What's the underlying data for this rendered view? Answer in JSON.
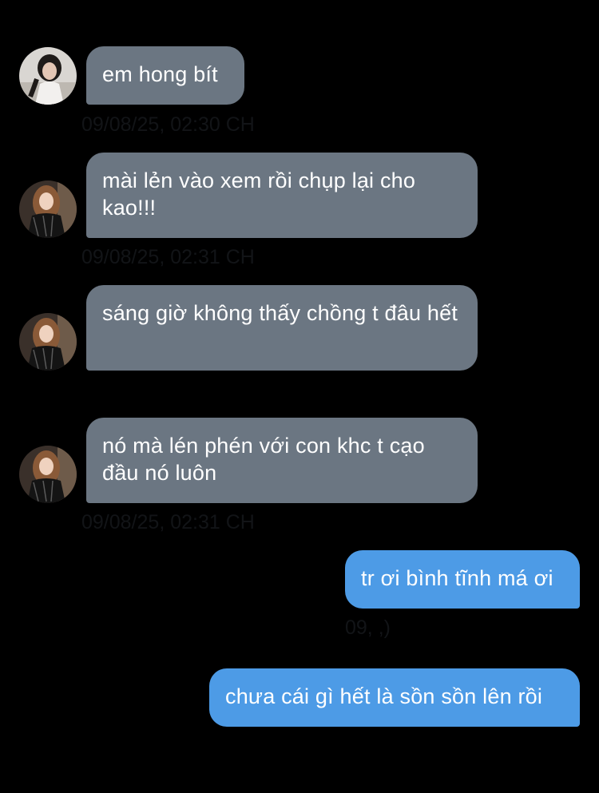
{
  "colors": {
    "background": "#000000",
    "incoming_bubble": "#6b7682",
    "outgoing_bubble": "#4d9be6",
    "timestamp": "#121417"
  },
  "messages": [
    {
      "direction": "incoming",
      "text": "em hong bít",
      "avatar": "avatar-dark-hair",
      "timestamp": "09/08/25, 02:30 CH"
    },
    {
      "direction": "incoming",
      "text": "mài lẻn vào xem rồi chụp lại cho kao!!!",
      "avatar": "avatar-long-hair",
      "timestamp": "09/08/25, 02:31 CH"
    },
    {
      "direction": "incoming",
      "text": "sáng giờ không thấy chồng t đâu hết",
      "avatar": "avatar-long-hair",
      "timestamp": ""
    },
    {
      "direction": "incoming",
      "text": "nó mà lén phén với con khc t cạo đầu nó luôn",
      "avatar": "avatar-long-hair",
      "timestamp": "09/08/25, 02:31 CH"
    },
    {
      "direction": "outgoing",
      "text": "tr ơi bình tĩnh má ơi",
      "timestamp": "09, ,)"
    },
    {
      "direction": "outgoing",
      "text": "chưa cái gì hết là sồn sồn lên rồi",
      "timestamp": ""
    }
  ]
}
